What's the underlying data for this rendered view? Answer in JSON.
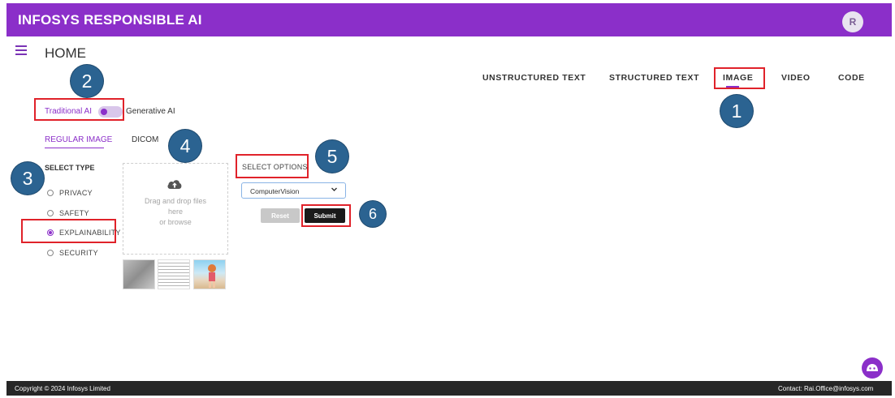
{
  "header": {
    "title": "INFOSYS RESPONSIBLE AI",
    "avatar_initial": "R"
  },
  "page": {
    "title": "HOME"
  },
  "tabs": [
    {
      "label": "UNSTRUCTURED TEXT"
    },
    {
      "label": "STRUCTURED TEXT"
    },
    {
      "label": "IMAGE",
      "active": true
    },
    {
      "label": "VIDEO"
    },
    {
      "label": "CODE"
    }
  ],
  "ai_toggle": {
    "left_label": "Traditional AI",
    "right_label": "Generative AI",
    "selected": "Traditional AI"
  },
  "image_type_tabs": [
    {
      "label": "REGULAR IMAGE",
      "active": true
    },
    {
      "label": "DICOM"
    }
  ],
  "select_type": {
    "heading": "SELECT TYPE",
    "options": [
      {
        "label": "PRIVACY",
        "checked": false
      },
      {
        "label": "SAFETY",
        "checked": false
      },
      {
        "label": "EXPLAINABILITY",
        "checked": true
      },
      {
        "label": "SECURITY",
        "checked": false
      }
    ]
  },
  "dropzone": {
    "line1": "Drag and drop files",
    "line2": "here",
    "line3": "or browse"
  },
  "options": {
    "heading": "SELECT OPTIONS",
    "dropdown_value": "ComputerVision",
    "reset_label": "Reset",
    "submit_label": "Submit"
  },
  "callouts": [
    "1",
    "2",
    "3",
    "4",
    "5",
    "6"
  ],
  "footer": {
    "copyright": "Copyright © 2024 Infosys Limited",
    "contact": "Contact: Rai.Office@infosys.com"
  },
  "colors": {
    "brand": "#8b2fc9",
    "highlight": "#e0222a",
    "callout": "#2b6391",
    "footer": "#262626"
  },
  "icons": [
    "menu-icon",
    "cloud-upload-icon",
    "chevron-down-icon",
    "chat-bot-icon"
  ]
}
